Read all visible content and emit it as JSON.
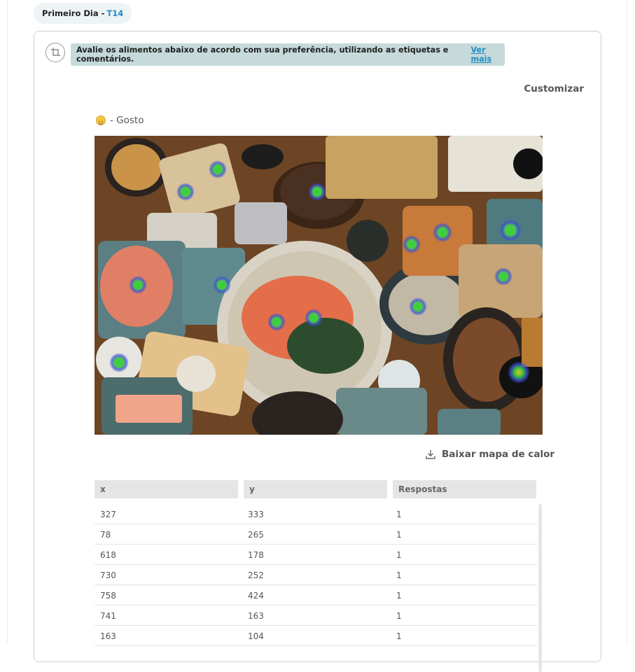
{
  "header": {
    "tab_label": "Primeiro Dia - ",
    "tab_tag": "T14"
  },
  "instructions": {
    "text": "Avalie os alimentos abaixo de acordo com sua preferência, utilizando as etiquetas e comentários.",
    "more_label": "Ver mais",
    "icon": "crop-icon"
  },
  "customize_label": "Customizar",
  "question": {
    "emoji": "smiling-face-icon",
    "label": "- Gosto"
  },
  "download_label": "Baixar mapa de calor",
  "table": {
    "columns": [
      "x",
      "y",
      "Respostas"
    ],
    "rows": [
      {
        "x": "327",
        "y": "333",
        "r": "1"
      },
      {
        "x": "78",
        "y": "265",
        "r": "1"
      },
      {
        "x": "618",
        "y": "178",
        "r": "1"
      },
      {
        "x": "730",
        "y": "252",
        "r": "1"
      },
      {
        "x": "758",
        "y": "424",
        "r": "1"
      },
      {
        "x": "741",
        "y": "163",
        "r": "1"
      },
      {
        "x": "163",
        "y": "104",
        "r": "1"
      }
    ]
  },
  "colors": {
    "tag_blue": "#1b8ec5",
    "banner_bg": "#c6dadb",
    "heat_green": "#3ec83e",
    "heat_blue": "#3a4fd6"
  }
}
